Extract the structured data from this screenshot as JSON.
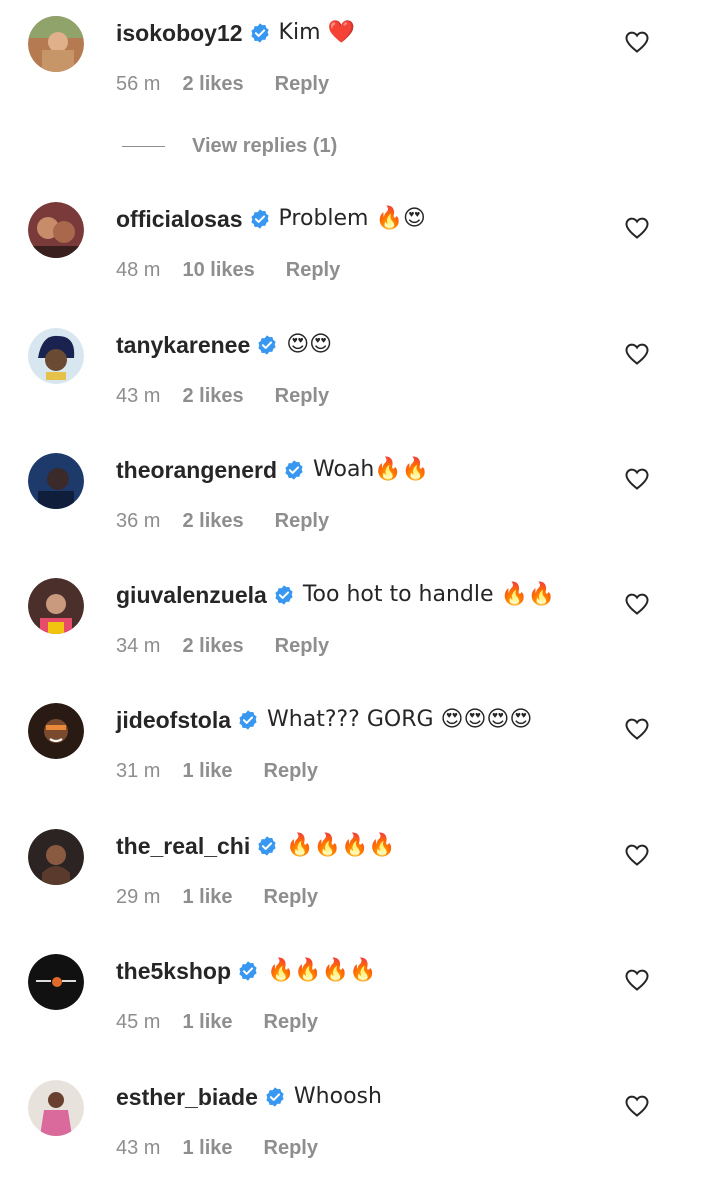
{
  "comments": [
    {
      "username": "isokoboy12",
      "text": "Kim ❤️",
      "time": "56 m",
      "likes": "2 likes",
      "reply": "Reply",
      "avatar_color": "#b67a52"
    },
    {
      "username": "officialosas",
      "text": "Problem 🔥😍",
      "time": "48 m",
      "likes": "10 likes",
      "reply": "Reply",
      "avatar_color": "#7a3a3a"
    },
    {
      "username": "tanykarenee",
      "text": "😍😍",
      "time": "43 m",
      "likes": "2 likes",
      "reply": "Reply",
      "avatar_color": "#d8e6ef"
    },
    {
      "username": "theorangenerd",
      "text": "Woah🔥🔥",
      "time": "36 m",
      "likes": "2 likes",
      "reply": "Reply",
      "avatar_color": "#1d3a6b"
    },
    {
      "username": "giuvalenzuela",
      "text": "Too hot to handle 🔥🔥",
      "time": "34 m",
      "likes": "2 likes",
      "reply": "Reply",
      "avatar_color": "#4a2f2a"
    },
    {
      "username": "jideofstola",
      "text": "What??? GORG 😍😍😍😍",
      "time": "31 m",
      "likes": "1 like",
      "reply": "Reply",
      "avatar_color": "#2a1a14"
    },
    {
      "username": "the_real_chi",
      "text": "🔥🔥🔥🔥",
      "time": "29 m",
      "likes": "1 like",
      "reply": "Reply",
      "avatar_color": "#2b2422"
    },
    {
      "username": "the5kshop",
      "text": "🔥🔥🔥🔥",
      "time": "45 m",
      "likes": "1 like",
      "reply": "Reply",
      "avatar_color": "#111111"
    },
    {
      "username": "esther_biade",
      "text": "Whoosh",
      "time": "43 m",
      "likes": "1 like",
      "reply": "Reply",
      "avatar_color": "#d96a9b"
    }
  ],
  "view_replies": "View replies (1)",
  "colors": {
    "verified": "#3897f0",
    "muted": "#8e8e8e",
    "text": "#262626"
  },
  "icons": {
    "verified": "verified-badge-icon",
    "like": "heart-outline-icon"
  }
}
